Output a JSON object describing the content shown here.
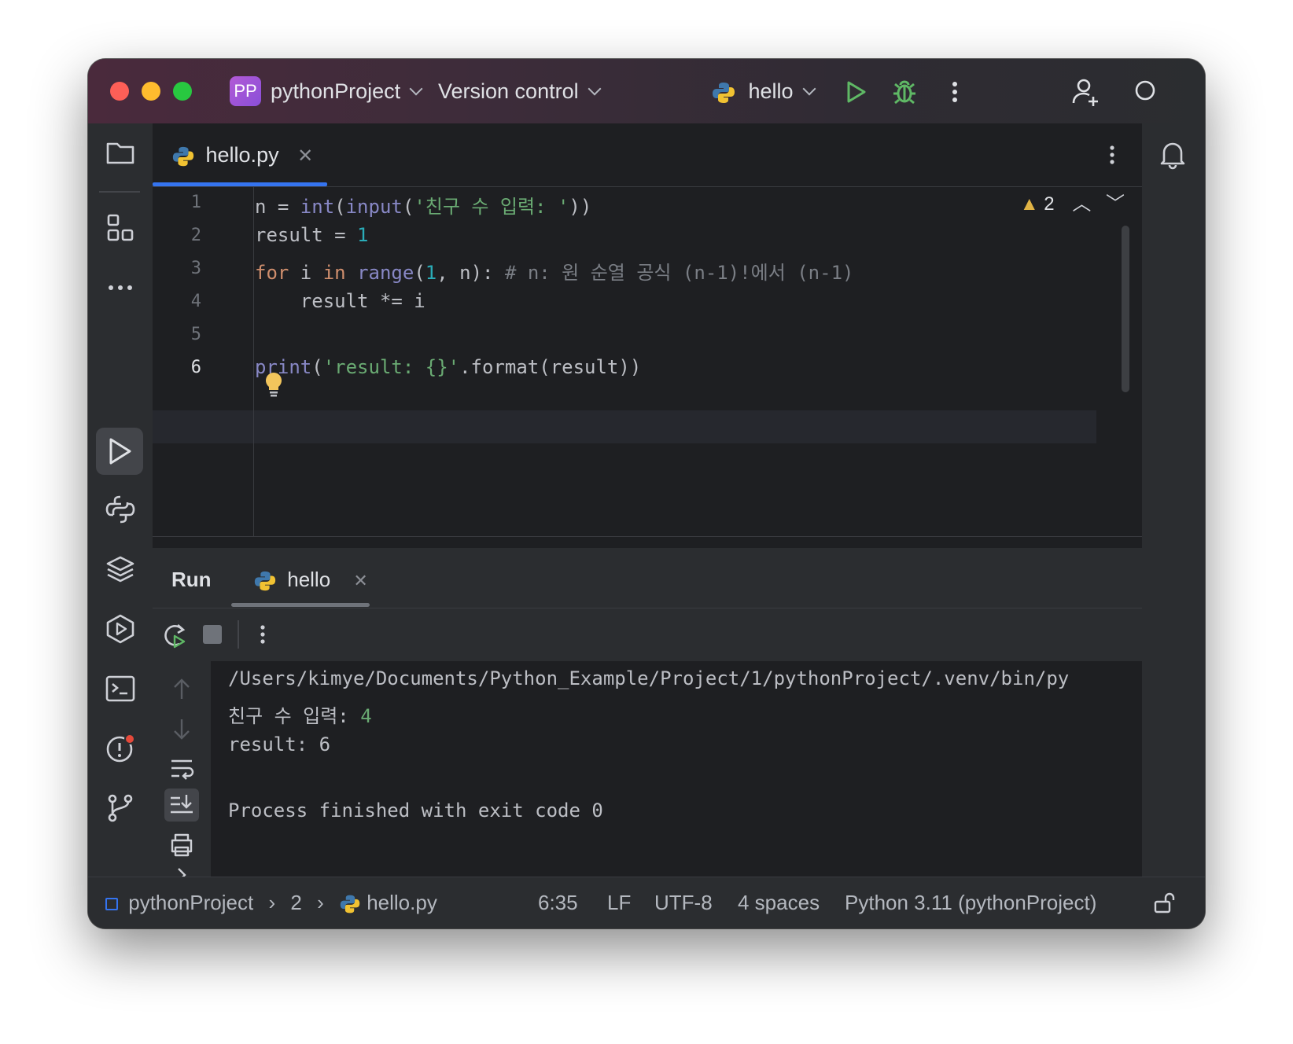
{
  "titlebar": {
    "project_badge": "PP",
    "project_name": "pythonProject",
    "version_control": "Version control",
    "run_config": "hello"
  },
  "editor": {
    "tab_filename": "hello.py",
    "line_numbers": [
      "1",
      "2",
      "3",
      "4",
      "5",
      "6"
    ],
    "warning_count": "2"
  },
  "run_panel": {
    "title": "Run",
    "tab_name": "hello"
  },
  "console": {
    "path_line": "/Users/kimye/Documents/Python_Example/Project/1/pythonProject/.venv/bin/py",
    "prompt": "친구 수 입력: ",
    "input_value": "4",
    "result_line": "result: 6",
    "exit_line": "Process finished with exit code 0"
  },
  "statusbar": {
    "project": "pythonProject",
    "crumb_2": "2",
    "file": "hello.py",
    "position": "6:35",
    "line_sep": "LF",
    "encoding": "UTF-8",
    "indent": "4 spaces",
    "interpreter": "Python 3.11 (pythonProject)"
  },
  "colors": {
    "accent": "#3574f0",
    "run_green": "#5fb865",
    "keyword": "#cf8e6d",
    "string": "#6aab73",
    "builtin": "#8888c6"
  },
  "icons": [
    "folder-icon",
    "structure-icon",
    "more-icon",
    "run-icon",
    "python-console-icon",
    "packages-icon",
    "services-icon",
    "terminal-icon",
    "problems-icon",
    "git-icon",
    "bell-icon",
    "debug-icon",
    "add-user-icon",
    "search-icon",
    "lock-icon"
  ]
}
